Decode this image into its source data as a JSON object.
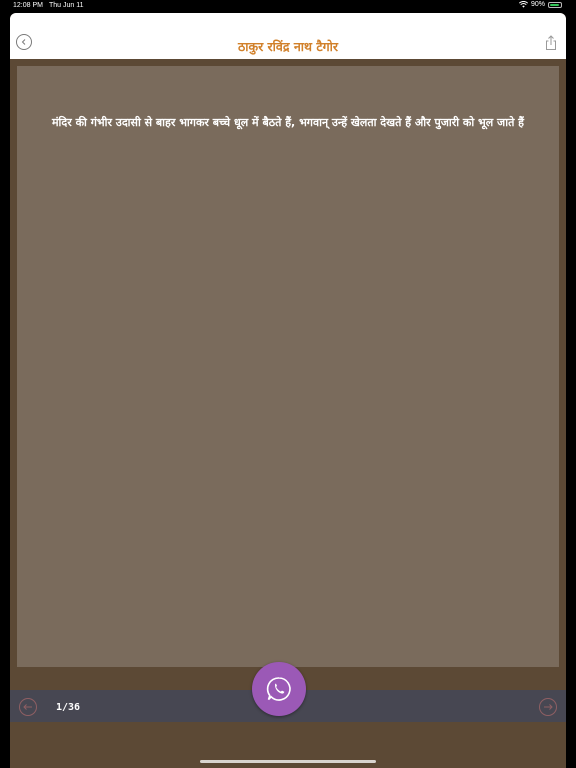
{
  "status_bar": {
    "time": "12:08 PM",
    "date": "Thu Jun 11",
    "battery": "90%",
    "battery_level": 0.9
  },
  "nav": {
    "title": "ठाकुर रविंद्र नाथ टैगोर",
    "back_icon": "chevron-left-circle-icon",
    "share_icon": "share-icon"
  },
  "quote": {
    "text": "मंदिर की गंभीर उदासी से बाहर भागकर बच्चे धूल में बैठते हैं, भगवान् उन्हें खेलता देखते हैं और पुजारी को भूल जाते हैं"
  },
  "pager": {
    "counter": "1/36",
    "prev_icon": "arrow-left-circle-icon",
    "next_icon": "arrow-right-circle-icon"
  },
  "share": {
    "whatsapp_icon": "whatsapp-icon"
  },
  "colors": {
    "title": "#d1802a",
    "card": "#7a6b5c",
    "background": "#5c4935",
    "bottom_bar": "#474752",
    "whatsapp_button": "#9b59b6"
  }
}
